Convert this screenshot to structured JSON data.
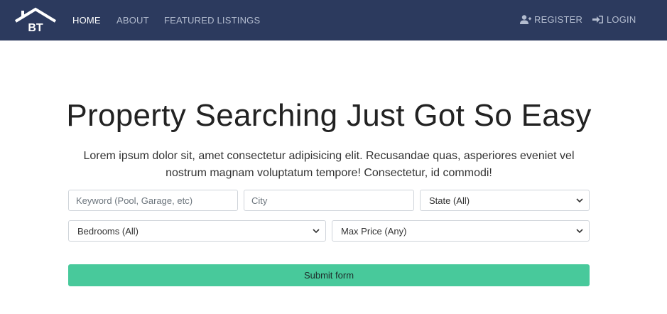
{
  "brand": {
    "logo_text": "BT",
    "icon": "house-logo-icon"
  },
  "nav": {
    "home": "HOME",
    "about": "ABOUT",
    "featured": "FEATURED LISTINGS",
    "register": "REGISTER",
    "login": "LOGIN",
    "register_icon": "user-plus-icon",
    "login_icon": "sign-in-icon"
  },
  "hero": {
    "title": "Property Searching Just Got So Easy",
    "subtitle": "Lorem ipsum dolor sit, amet consectetur adipisicing elit. Recusandae quas, asperiores eveniet vel nostrum magnam voluptatum tempore! Consectetur, id commodi!"
  },
  "search": {
    "keyword_placeholder": "Keyword (Pool, Garage, etc)",
    "city_placeholder": "City",
    "state_selected": "State (All)",
    "bedrooms_selected": "Bedrooms (All)",
    "price_selected": "Max Price (Any)",
    "submit_label": "Submit form"
  },
  "colors": {
    "navbar": "#2c3a5e",
    "accent": "#48c99b"
  }
}
